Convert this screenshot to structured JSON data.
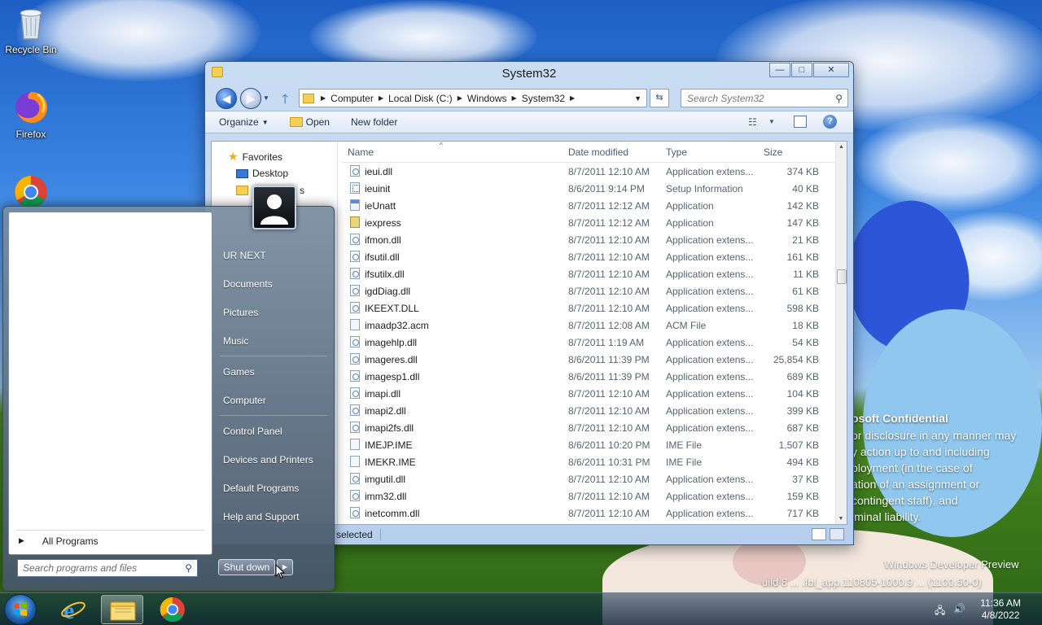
{
  "desktop": {
    "icons": [
      {
        "label": "Recycle Bin",
        "icon": "recycle-bin-icon"
      },
      {
        "label": "Firefox",
        "icon": "firefox-icon"
      },
      {
        "label": "",
        "icon": "chrome-icon"
      }
    ],
    "watermark": {
      "confidential_title": "osoft Confidential",
      "confidential_lines": [
        "or disclosure in any manner may",
        "y action up to and including",
        "ployment (in the case of",
        "ation of an assignment or",
        "contingent staff), and",
        "iminal liability."
      ],
      "build_line1": "Windows Developer Preview",
      "build_line2": "uild 8 ... .fbl_app.110805-1000.9 ... (1100.50-0)"
    }
  },
  "explorer": {
    "title": "System32",
    "caption_buttons": {
      "minimize": "—",
      "maximize": "□",
      "close": "✕"
    },
    "breadcrumb": [
      "Computer",
      "Local Disk (C:)",
      "Windows",
      "System32"
    ],
    "search_placeholder": "Search System32",
    "toolbar": {
      "organize": "Organize",
      "open": "Open",
      "new_folder": "New folder"
    },
    "nav_pane": {
      "favorites": "Favorites",
      "desktop": "Desktop",
      "downloads": "s"
    },
    "columns": {
      "name": "Name",
      "date": "Date modified",
      "type": "Type",
      "size": "Size"
    },
    "files": [
      {
        "name": "ieui.dll",
        "date": "8/7/2011 12:10 AM",
        "type": "Application extens...",
        "size": "374 KB",
        "icon": "dll"
      },
      {
        "name": "ieuinit",
        "date": "8/6/2011 9:14 PM",
        "type": "Setup Information",
        "size": "40 KB",
        "icon": "inf"
      },
      {
        "name": "ieUnatt",
        "date": "8/7/2011 12:12 AM",
        "type": "Application",
        "size": "142 KB",
        "icon": "app"
      },
      {
        "name": "iexpress",
        "date": "8/7/2011 12:12 AM",
        "type": "Application",
        "size": "147 KB",
        "icon": "exp"
      },
      {
        "name": "ifmon.dll",
        "date": "8/7/2011 12:10 AM",
        "type": "Application extens...",
        "size": "21 KB",
        "icon": "dll"
      },
      {
        "name": "ifsutil.dll",
        "date": "8/7/2011 12:10 AM",
        "type": "Application extens...",
        "size": "161 KB",
        "icon": "dll"
      },
      {
        "name": "ifsutilx.dll",
        "date": "8/7/2011 12:10 AM",
        "type": "Application extens...",
        "size": "11 KB",
        "icon": "dll"
      },
      {
        "name": "igdDiag.dll",
        "date": "8/7/2011 12:10 AM",
        "type": "Application extens...",
        "size": "61 KB",
        "icon": "dll"
      },
      {
        "name": "IKEEXT.DLL",
        "date": "8/7/2011 12:10 AM",
        "type": "Application extens...",
        "size": "598 KB",
        "icon": "dll"
      },
      {
        "name": "imaadp32.acm",
        "date": "8/7/2011 12:08 AM",
        "type": "ACM File",
        "size": "18 KB",
        "icon": "blank"
      },
      {
        "name": "imagehlp.dll",
        "date": "8/7/2011 1:19 AM",
        "type": "Application extens...",
        "size": "54 KB",
        "icon": "dll"
      },
      {
        "name": "imageres.dll",
        "date": "8/6/2011 11:39 PM",
        "type": "Application extens...",
        "size": "25,854 KB",
        "icon": "dll"
      },
      {
        "name": "imagesp1.dll",
        "date": "8/6/2011 11:39 PM",
        "type": "Application extens...",
        "size": "689 KB",
        "icon": "dll"
      },
      {
        "name": "imapi.dll",
        "date": "8/7/2011 12:10 AM",
        "type": "Application extens...",
        "size": "104 KB",
        "icon": "dll"
      },
      {
        "name": "imapi2.dll",
        "date": "8/7/2011 12:10 AM",
        "type": "Application extens...",
        "size": "399 KB",
        "icon": "dll"
      },
      {
        "name": "imapi2fs.dll",
        "date": "8/7/2011 12:10 AM",
        "type": "Application extens...",
        "size": "687 KB",
        "icon": "dll"
      },
      {
        "name": "IMEJP.IME",
        "date": "8/6/2011 10:20 PM",
        "type": "IME File",
        "size": "1,507 KB",
        "icon": "blank"
      },
      {
        "name": "IMEKR.IME",
        "date": "8/6/2011 10:31 PM",
        "type": "IME File",
        "size": "494 KB",
        "icon": "blank"
      },
      {
        "name": "imgutil.dll",
        "date": "8/7/2011 12:10 AM",
        "type": "Application extens...",
        "size": "37 KB",
        "icon": "dll"
      },
      {
        "name": "imm32.dll",
        "date": "8/7/2011 12:10 AM",
        "type": "Application extens...",
        "size": "159 KB",
        "icon": "dll"
      },
      {
        "name": "inetcomm.dll",
        "date": "8/7/2011 12:10 AM",
        "type": "Application extens...",
        "size": "717 KB",
        "icon": "dll"
      }
    ],
    "status": "selected"
  },
  "start_menu": {
    "right_items": [
      "UR NEXT",
      "Documents",
      "Pictures",
      "Music",
      "Games",
      "Computer",
      "Control Panel",
      "Devices and Printers",
      "Default Programs",
      "Help and Support"
    ],
    "all_programs": "All Programs",
    "search_placeholder": "Search programs and files",
    "shutdown": "Shut down"
  },
  "taskbar": {
    "time": "11:36 AM",
    "date": "4/8/2022"
  }
}
